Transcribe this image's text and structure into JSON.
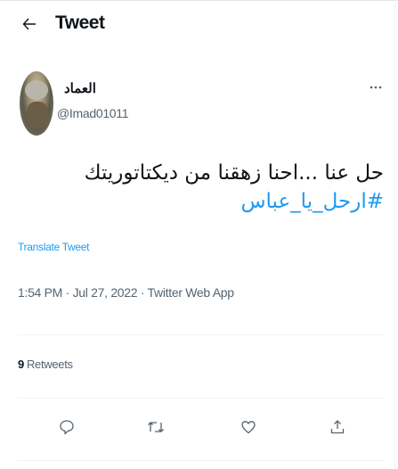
{
  "header": {
    "title": "Tweet",
    "back_icon": "arrow-left-icon"
  },
  "author": {
    "display_name": "العماد",
    "handle": "@Imad01011",
    "more_icon": "more-horizontal-icon"
  },
  "tweet": {
    "text": "حل عنا ...احنا زهقنا من ديكتاتوريتك",
    "hashtag": "#ارحل_يا_عباس",
    "translate_label": "Translate Tweet",
    "timestamp": "1:54 PM · Jul 27, 2022 · Twitter Web App"
  },
  "stats": {
    "retweets_count": "9",
    "retweets_label": "Retweets"
  },
  "actions": [
    {
      "name": "reply",
      "icon": "reply-icon"
    },
    {
      "name": "retweet",
      "icon": "retweet-icon"
    },
    {
      "name": "like",
      "icon": "heart-icon"
    },
    {
      "name": "share",
      "icon": "share-icon"
    }
  ],
  "colors": {
    "link": "#1d9bf0",
    "text": "#0f1419",
    "secondary": "#536471",
    "divider": "#eff3f4"
  }
}
